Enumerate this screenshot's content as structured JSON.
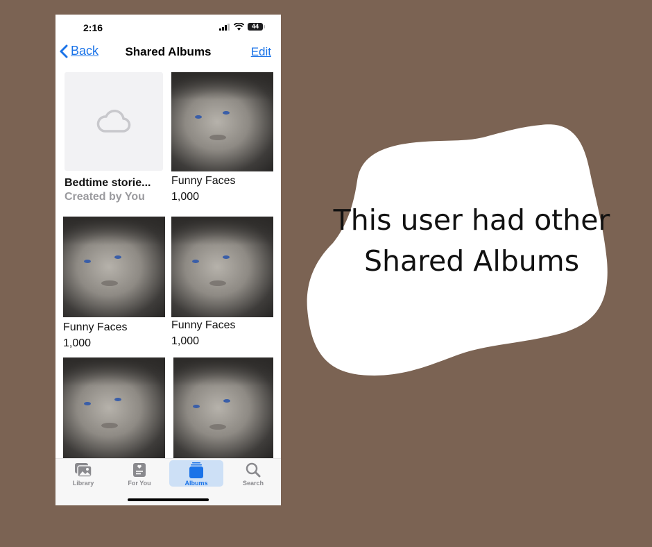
{
  "status_bar": {
    "time": "2:16",
    "battery": "44"
  },
  "nav": {
    "back_label": "Back",
    "title": "Shared Albums",
    "edit_label": "Edit"
  },
  "albums": [
    {
      "title": "Bedtime storie...",
      "subtitle": "Created by You",
      "type": "placeholder"
    },
    {
      "title": "Funny Faces",
      "subtitle": "1,000",
      "type": "photo"
    },
    {
      "title": "Funny Faces",
      "subtitle": "1,000",
      "type": "photo"
    },
    {
      "title": "Funny Faces",
      "subtitle": "1,000",
      "type": "photo"
    },
    {
      "title": "",
      "subtitle": "",
      "type": "photo"
    },
    {
      "title": "",
      "subtitle": "",
      "type": "photo"
    }
  ],
  "tabs": [
    {
      "label": "Library",
      "icon": "photo-library-icon",
      "active": false
    },
    {
      "label": "For You",
      "icon": "for-you-icon",
      "active": false
    },
    {
      "label": "Albums",
      "icon": "albums-icon",
      "active": true
    },
    {
      "label": "Search",
      "icon": "search-icon",
      "active": false
    }
  ],
  "callout": {
    "text": "This user had other Shared Albums"
  },
  "colors": {
    "background": "#7b6353",
    "accent": "#1a73e8",
    "active_tab_bg": "#cde0f6"
  }
}
